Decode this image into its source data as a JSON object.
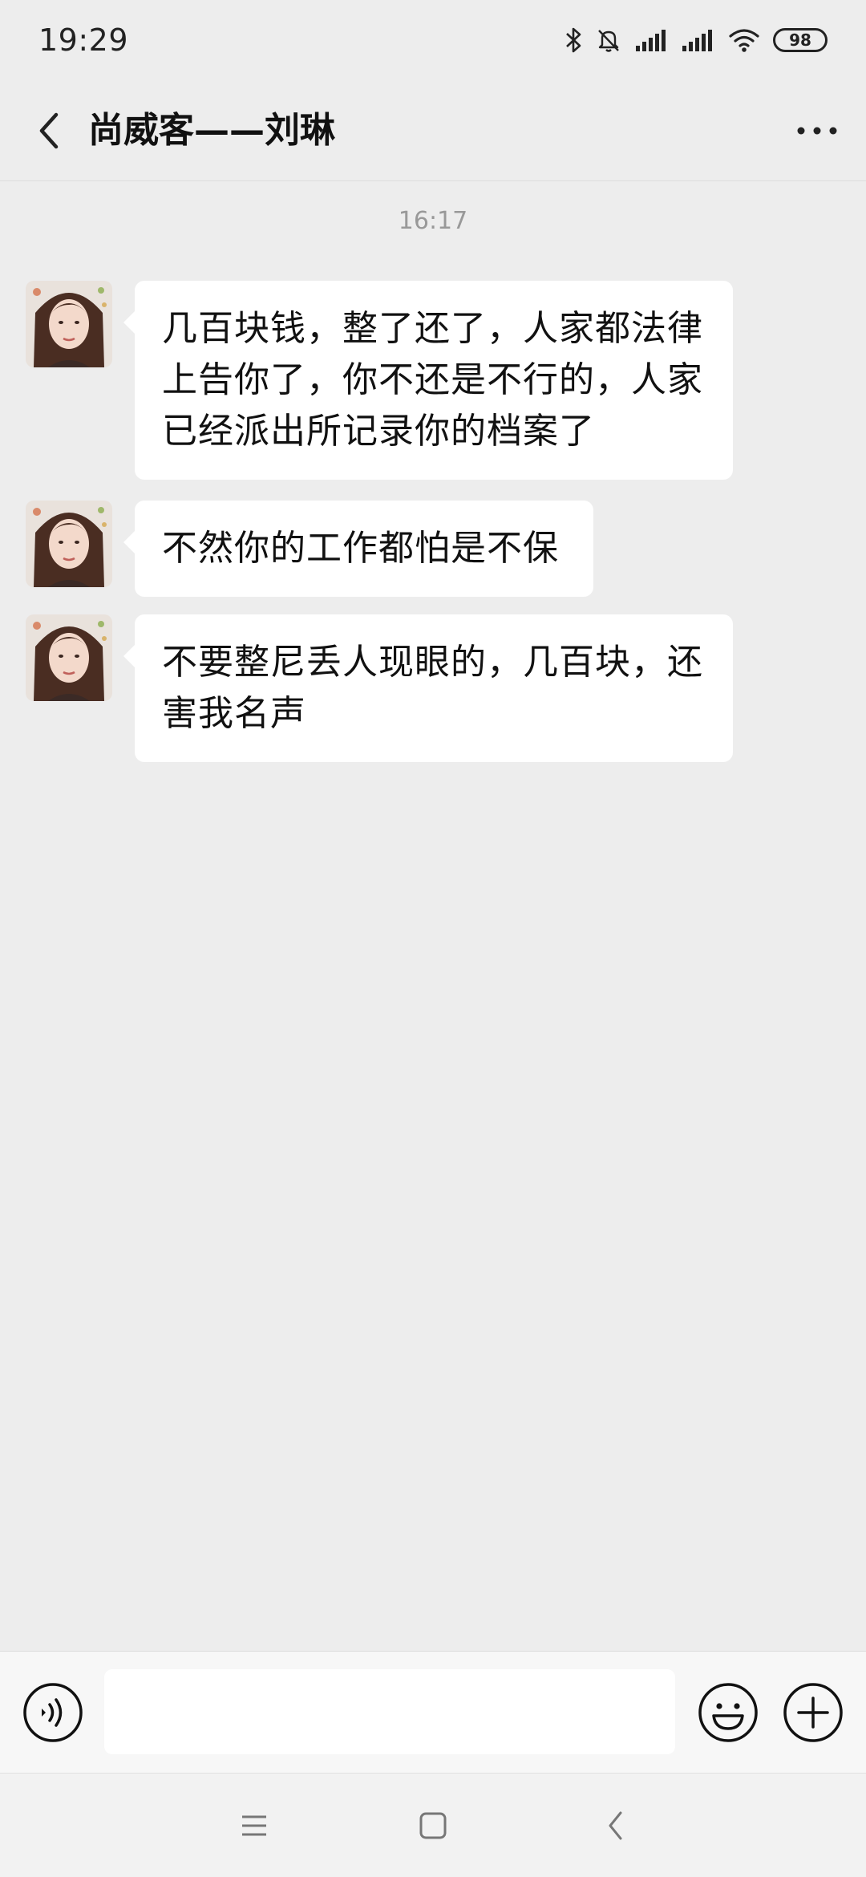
{
  "status_bar": {
    "time": "19:29",
    "battery": "98",
    "icons": [
      "bluetooth-icon",
      "mute-bell-icon",
      "signal-icon",
      "signal-icon",
      "wifi-icon",
      "battery-icon"
    ]
  },
  "header": {
    "title": "尚威客——刘琳",
    "back_icon": "chevron-left-icon",
    "more_icon": "more-dots-icon"
  },
  "chat": {
    "timestamp": "16:17",
    "messages": [
      {
        "sender": "other",
        "lines": [
          "几百块钱，整了还了，人家都法律",
          "上告你了，你不还是不行的，人家",
          "已经派出所记录你的档案了"
        ]
      },
      {
        "sender": "other",
        "lines": [
          "不然你的工作都怕是不保"
        ]
      },
      {
        "sender": "other",
        "lines": [
          "不要整尼丢人现眼的，几百块，还",
          "害我名声"
        ]
      }
    ]
  },
  "input_bar": {
    "voice_icon": "voice-icon",
    "input_value": "",
    "emoji_icon": "emoji-icon",
    "plus_icon": "plus-circle-icon"
  },
  "nav_bar": {
    "icons": [
      "menu-icon",
      "home-icon",
      "back-icon"
    ]
  },
  "colors": {
    "background": "#ededed",
    "bubble": "#ffffff",
    "text": "#111111",
    "timestamp": "#999999"
  }
}
